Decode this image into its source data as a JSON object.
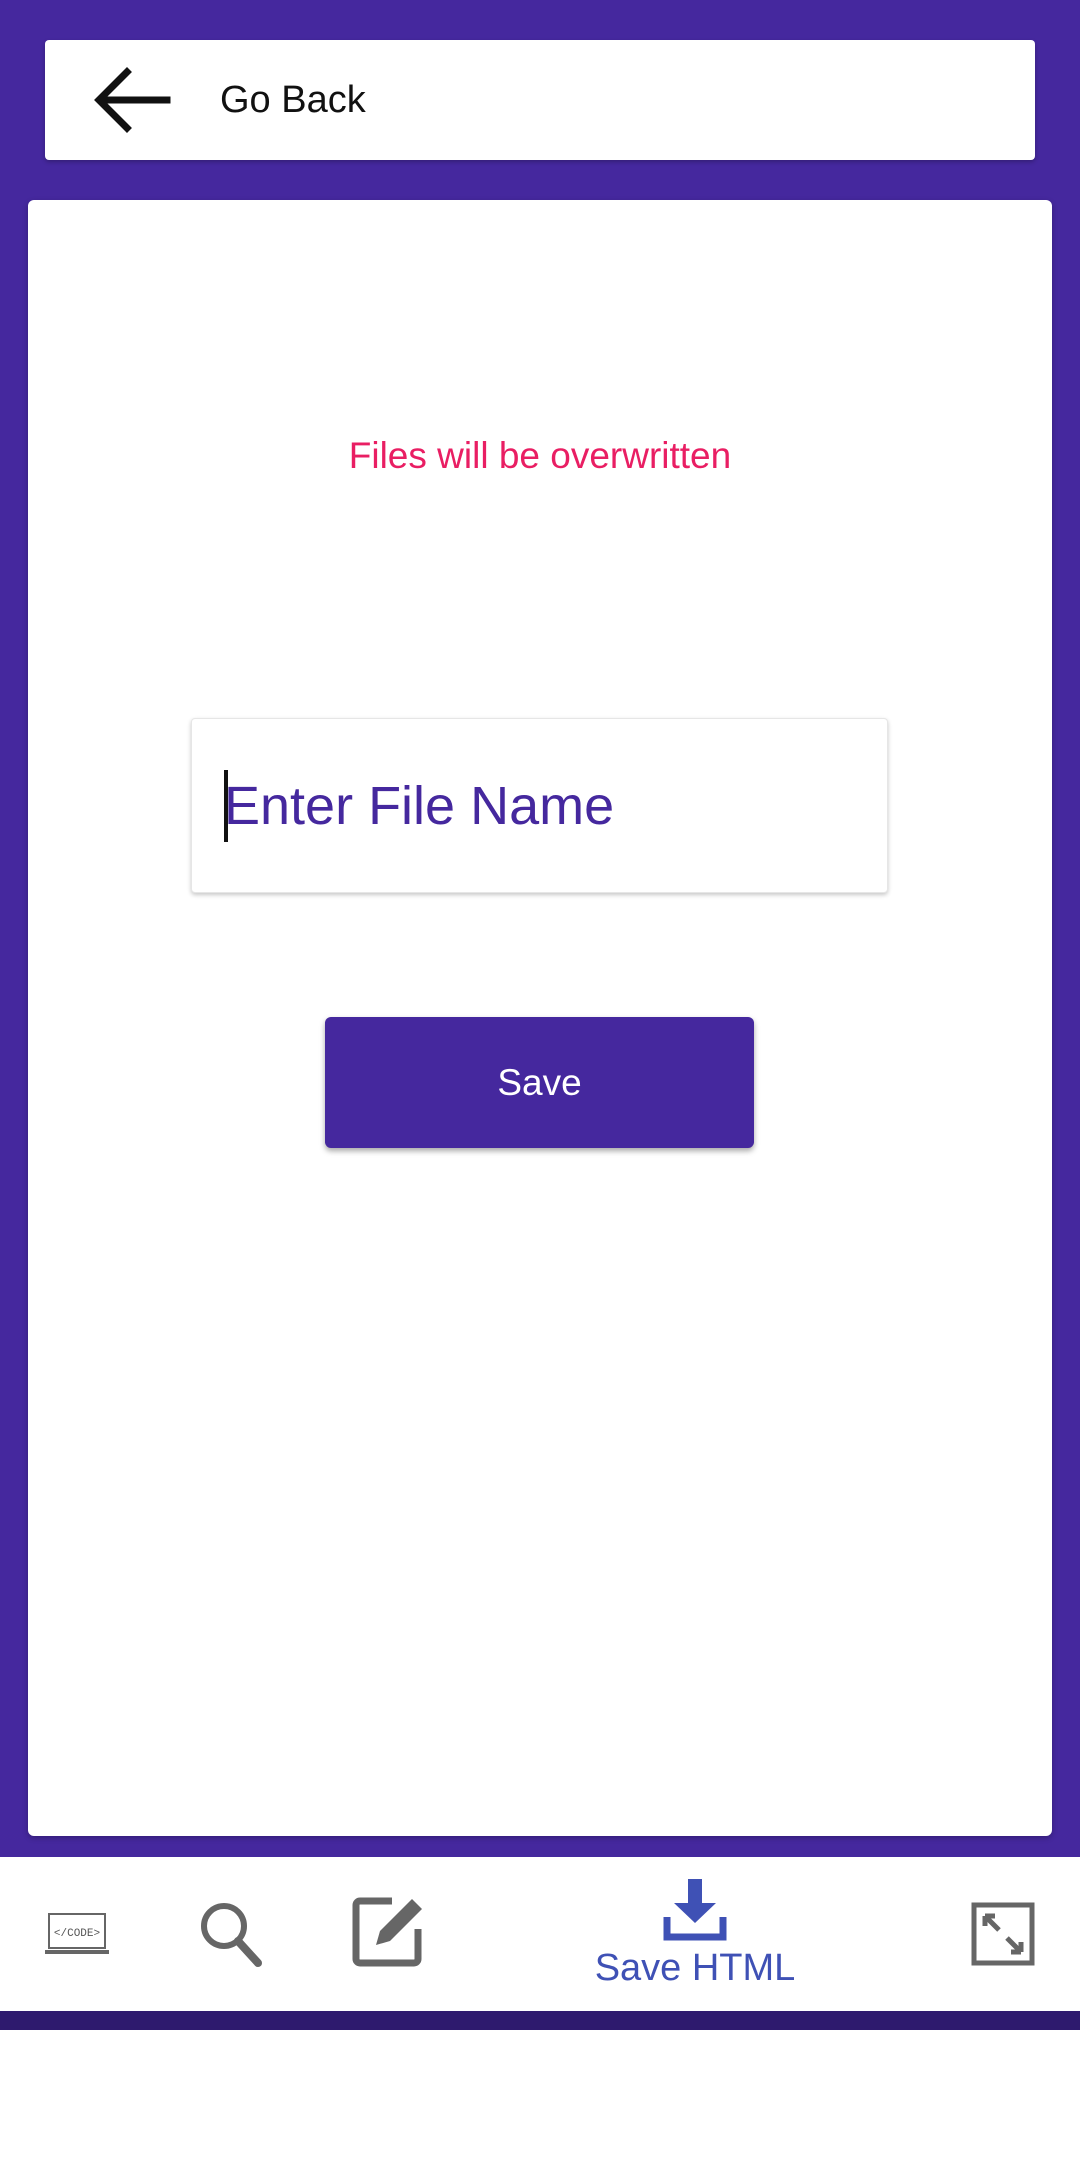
{
  "header": {
    "back_label": "Go Back"
  },
  "main": {
    "warning_text": "Files will be overwritten",
    "filename_input": {
      "placeholder": "Enter File Name",
      "value": ""
    },
    "save_button_label": "Save"
  },
  "bottom_nav": {
    "items": [
      {
        "icon": "code-icon",
        "label": ""
      },
      {
        "icon": "search-icon",
        "label": ""
      },
      {
        "icon": "edit-icon",
        "label": ""
      },
      {
        "icon": "download-icon",
        "label": "Save HTML",
        "active": true
      },
      {
        "icon": "fullscreen-icon",
        "label": ""
      }
    ],
    "code_icon_text": "</CODE>"
  },
  "colors": {
    "primary": "#45289e",
    "warning": "#e91e63",
    "active_nav": "#3f51b5",
    "inactive_icon": "#666666"
  }
}
